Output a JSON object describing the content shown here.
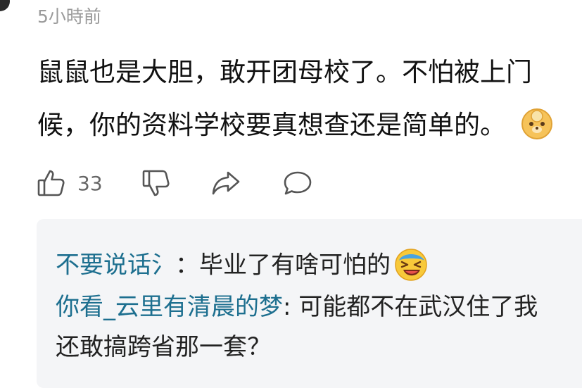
{
  "comment": {
    "timestamp": "5小時前",
    "text_line1": "鼠鼠也是大胆，敢开团母校了。不怕被上门",
    "text_line2": "候，你的资料学校要真想查还是简单的。",
    "emoji": "doge-emoji"
  },
  "actions": {
    "like_count": "33",
    "like_icon": "thumbs-up-icon",
    "dislike_icon": "thumbs-down-icon",
    "share_icon": "share-icon",
    "reply_icon": "comment-icon"
  },
  "replies": [
    {
      "user": "不要说话氵",
      "separator": "：",
      "text": "毕业了有啥可怕的",
      "emoji": "laughing-emoji"
    },
    {
      "user": "你看_云里有清晨的梦",
      "separator": ": ",
      "text": "可能都不在武汉住了我",
      "continuation": "还敢搞跨省那一套？"
    }
  ],
  "colors": {
    "username": "#1d6f8f",
    "reply_background": "#f4f5f7",
    "meta_text": "#9a9a9a"
  }
}
